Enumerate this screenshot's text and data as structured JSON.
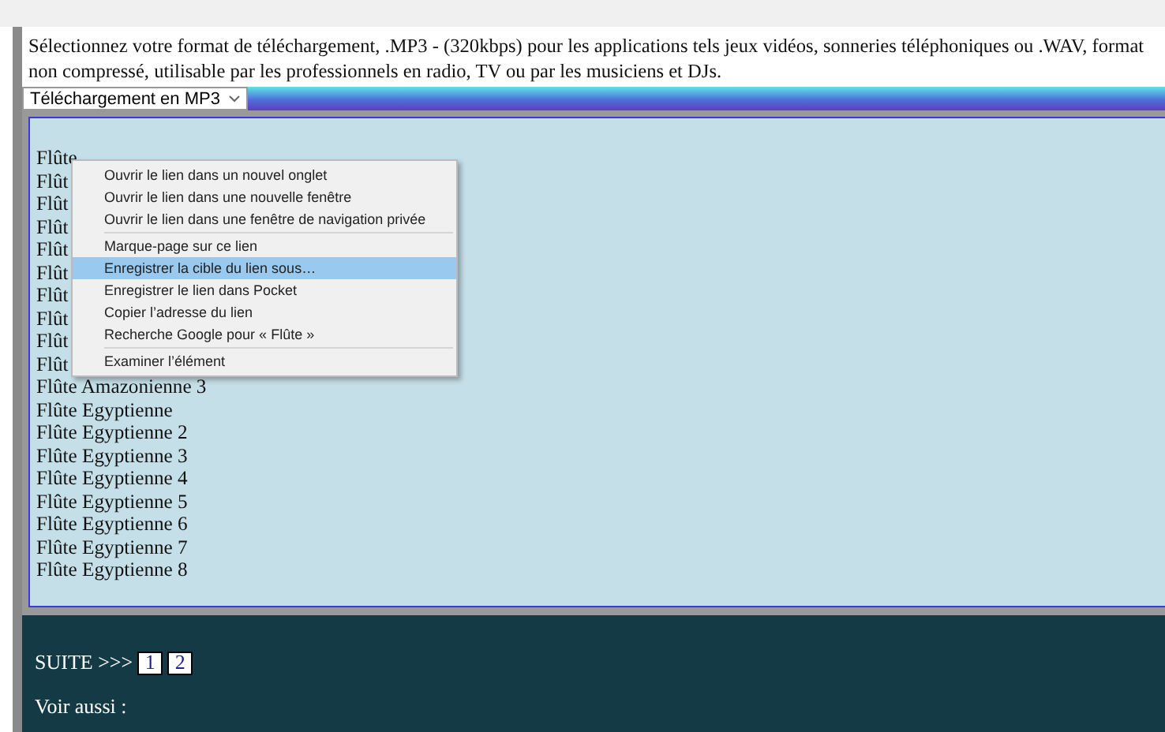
{
  "intro": "Sélectionnez votre format de téléchargement, .MP3 - (320kbps) pour les applications tels jeux vidéos, sonneries téléphoniques ou .WAV, format non compressé, utilisable par les professionnels en radio, TV ou par les musiciens et DJs.",
  "format_select": {
    "value": "Téléchargement en MP3"
  },
  "list": [
    "Flûte",
    "Flût",
    "Flût",
    "Flût",
    "Flût",
    "Flût",
    "Flût",
    "Flût",
    "Flût",
    "Flût",
    "Flûte Amazonienne 3",
    "Flûte Egyptienne",
    "Flûte Egyptienne 2",
    "Flûte Egyptienne 3",
    "Flûte Egyptienne 4",
    "Flûte Egyptienne 5",
    "Flûte Egyptienne 6",
    "Flûte Egyptienne 7",
    "Flûte Egyptienne 8"
  ],
  "context_menu": [
    {
      "label": "Ouvrir le lien dans un nouvel onglet",
      "selected": false,
      "separator_after": false
    },
    {
      "label": "Ouvrir le lien dans une nouvelle fenêtre",
      "selected": false,
      "separator_after": false
    },
    {
      "label": "Ouvrir le lien dans une fenêtre de navigation privée",
      "selected": false,
      "separator_after": true
    },
    {
      "label": "Marque-page sur ce lien",
      "selected": false,
      "separator_after": false
    },
    {
      "label": "Enregistrer la cible du lien sous…",
      "selected": true,
      "separator_after": false
    },
    {
      "label": "Enregistrer le lien dans Pocket",
      "selected": false,
      "separator_after": false
    },
    {
      "label": "Copier l’adresse du lien",
      "selected": false,
      "separator_after": false
    },
    {
      "label": "Recherche Google pour « Flûte »",
      "selected": false,
      "separator_after": true
    },
    {
      "label": "Examiner l’élément",
      "selected": false,
      "separator_after": false
    }
  ],
  "footer": {
    "next_label": "SUITE >>>",
    "pages": [
      "1",
      "2"
    ],
    "see_also": "Voir aussi :"
  }
}
